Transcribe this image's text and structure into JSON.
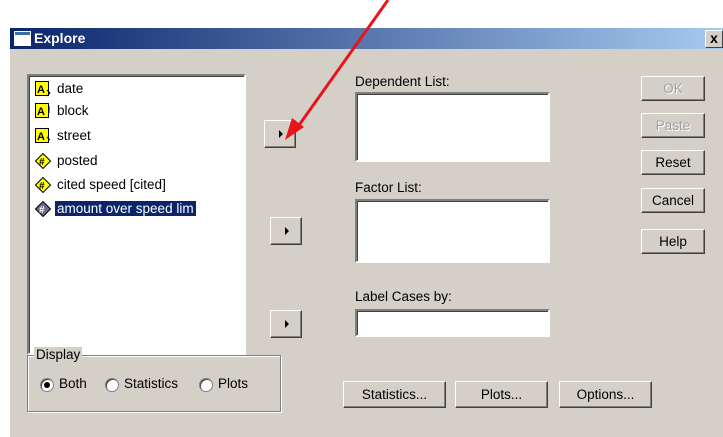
{
  "window": {
    "title": "Explore",
    "close_label": "x"
  },
  "variables": [
    {
      "label": "date",
      "icon": "string-variable-icon"
    },
    {
      "label": "block",
      "icon": "string-variable-icon"
    },
    {
      "label": "street",
      "icon": "string-variable-icon"
    },
    {
      "label": "posted",
      "icon": "numeric-variable-icon"
    },
    {
      "label": "cited speed [cited]",
      "icon": "numeric-variable-icon"
    },
    {
      "label": "amount over speed lim",
      "icon": "numeric-variable-icon",
      "selected": true
    }
  ],
  "targets": {
    "dependent_label": "Dependent List:",
    "factor_label": "Factor List:",
    "label_cases_label": "Label Cases by:"
  },
  "side_buttons": {
    "ok": "OK",
    "paste": "Paste",
    "reset": "Reset",
    "cancel": "Cancel",
    "help": "Help"
  },
  "display": {
    "title": "Display",
    "options": [
      "Both",
      "Statistics",
      "Plots"
    ],
    "selected": "Both"
  },
  "bottom_buttons": {
    "statistics": "Statistics...",
    "plots": "Plots...",
    "options": "Options..."
  },
  "colors": {
    "annotation_arrow": "#e8141c",
    "selection": "#0a246a",
    "titlebar": "#0a246a"
  }
}
